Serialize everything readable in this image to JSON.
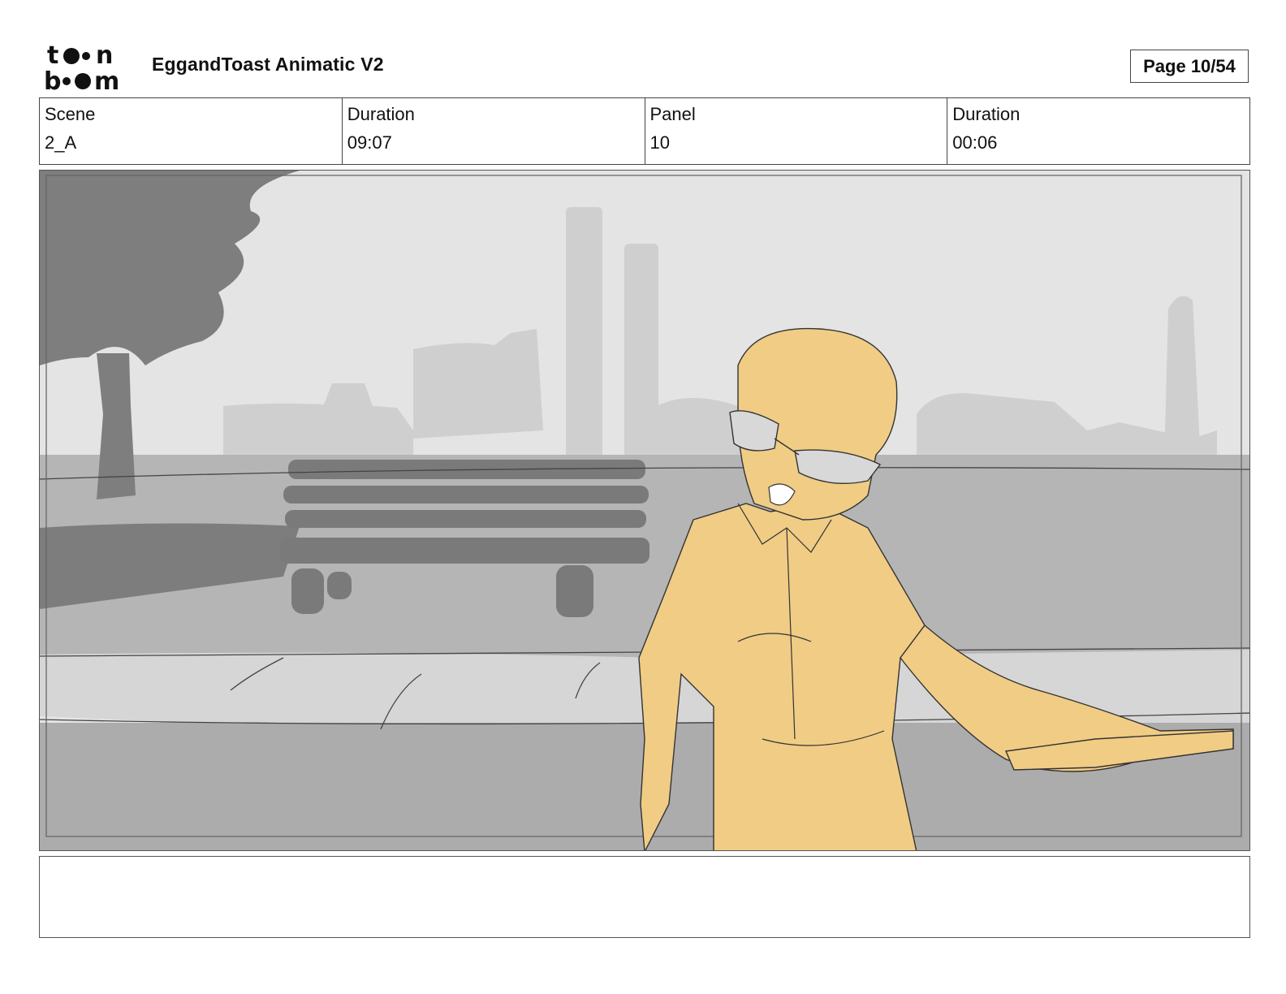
{
  "header": {
    "logo_text": "toon boom",
    "title": "EggandToast Animatic V2",
    "page": "Page 10/54"
  },
  "info": {
    "scene_label": "Scene",
    "scene_value": "2_A",
    "scene_duration_label": "Duration",
    "scene_duration_value": "09:07",
    "panel_label": "Panel",
    "panel_value": "10",
    "panel_duration_label": "Duration",
    "panel_duration_value": "00:06"
  },
  "panel_image": {
    "icon": "storyboard-sketch",
    "colors": {
      "sky": "#e3e3e3",
      "buildings": "#cfcfcf",
      "ground": "#b0b0b0",
      "dark": "#7a7a7a",
      "character": "#f0cc85"
    }
  },
  "notes": ""
}
